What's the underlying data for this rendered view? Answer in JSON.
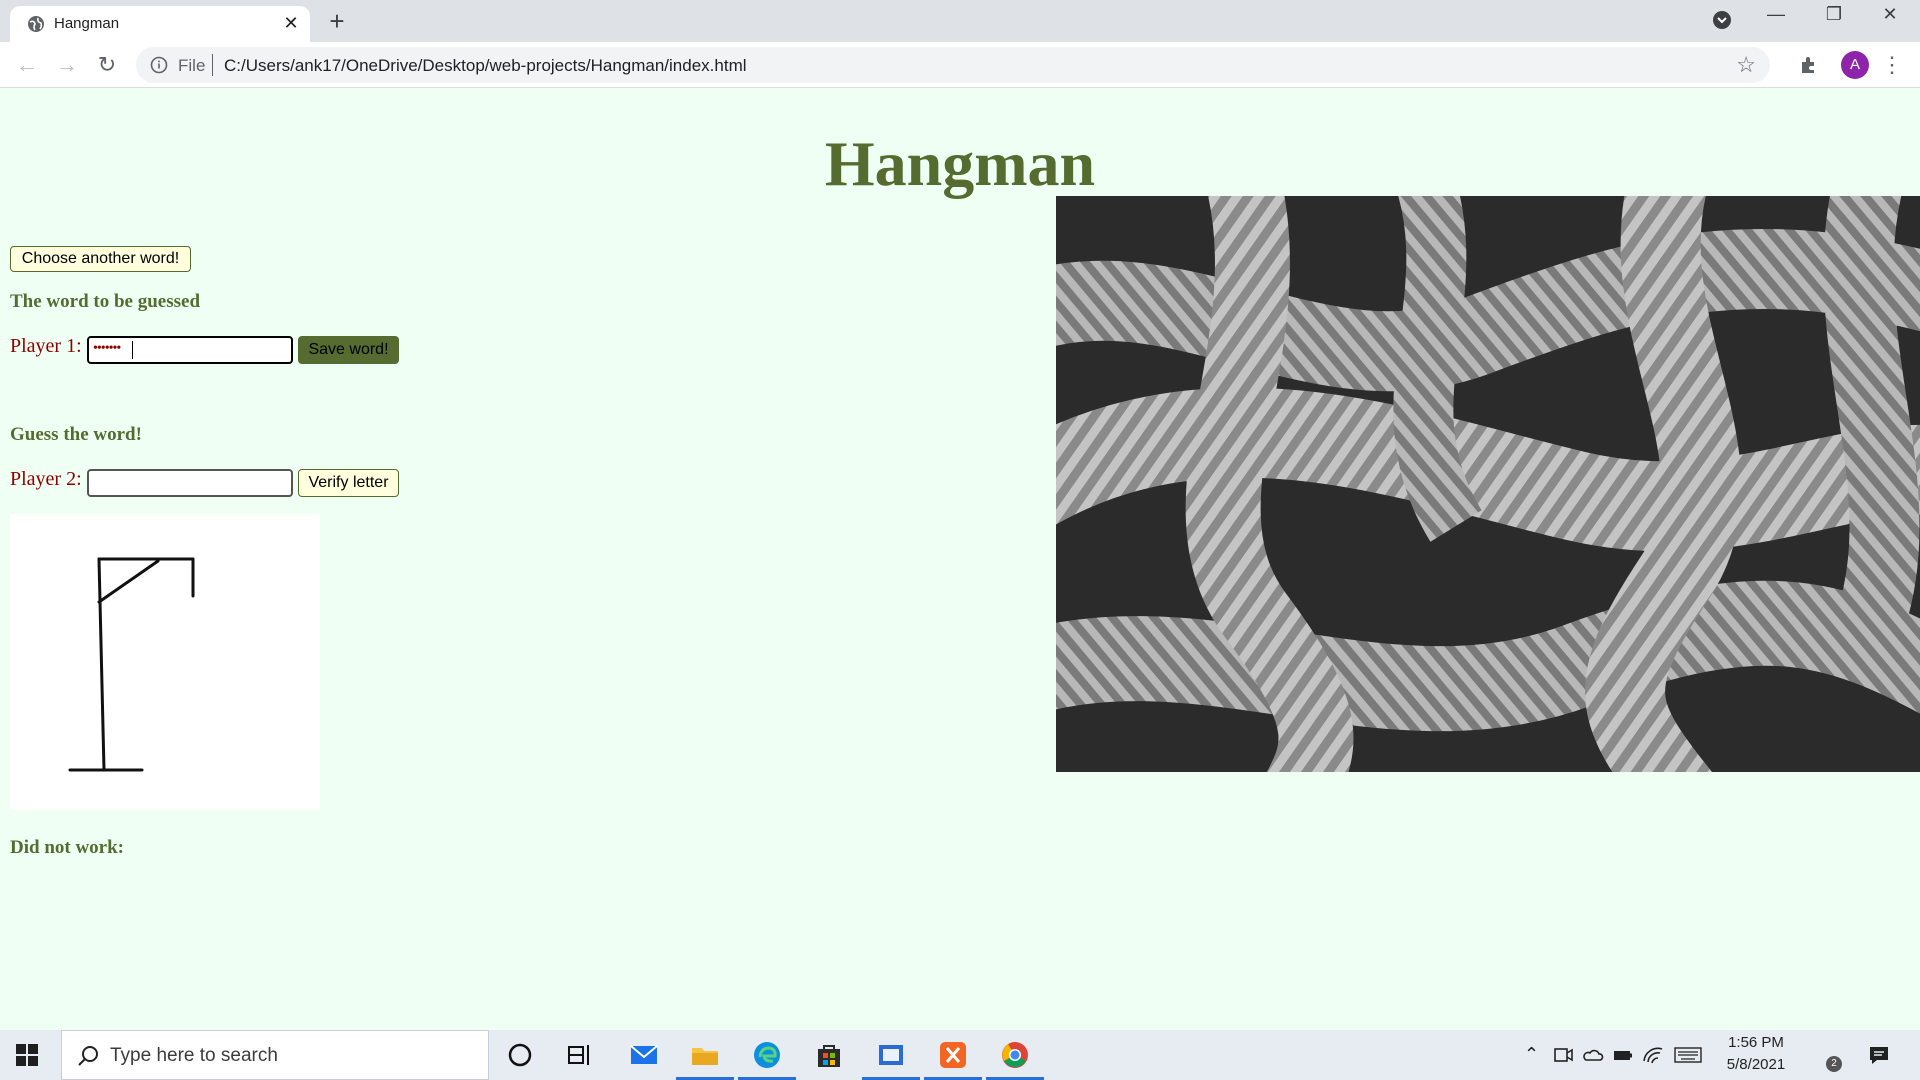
{
  "browser": {
    "tab_title": "Hangman",
    "new_tab": "+",
    "scheme": "File",
    "url": "C:/Users/ank17/OneDrive/Desktop/web-projects/Hangman/index.html",
    "profile_initial": "A"
  },
  "page": {
    "title": "Hangman",
    "choose_button": "Choose another word!",
    "word_section": "The word to be guessed",
    "player1_label": "Player 1:",
    "player1_value": "•••••••",
    "save_button": "Save word!",
    "guess_section": "Guess the word!",
    "player2_label": "Player 2:",
    "player2_value": "",
    "verify_button": "Verify letter",
    "failed_label": "Did not work:"
  },
  "colors": {
    "background": "#f0fff4",
    "accent": "#556b2f",
    "label": "#8b0000"
  },
  "taskbar": {
    "search_placeholder": "Type here to search",
    "time": "1:56 PM",
    "date": "5/8/2021",
    "notification_count": "2"
  }
}
